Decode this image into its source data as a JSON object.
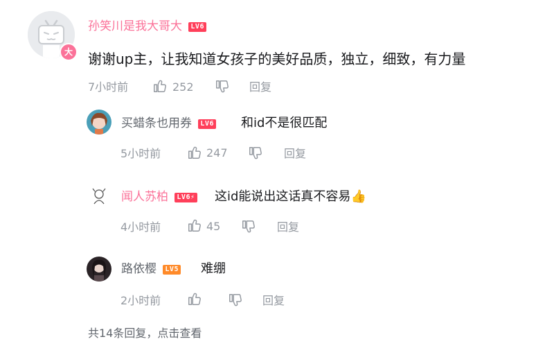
{
  "main_comment": {
    "username": "孙笑川是我大哥大",
    "level": "LV6",
    "avatar_badge": "大",
    "text": "谢谢up主，让我知道女孩子的美好品质，独立，细致，有力量",
    "time": "7小时前",
    "likes": "252",
    "reply_label": "回复"
  },
  "replies": [
    {
      "username": "买蜡条也用券",
      "level": "LV6",
      "text": "和id不是很匹配",
      "time": "5小时前",
      "likes": "247",
      "reply_label": "回复"
    },
    {
      "username": "闻人苏柏",
      "level": "LV6",
      "level_flag": "⚡",
      "text": "这id能说出这话真不容易",
      "emoji": "👍",
      "time": "4小时前",
      "likes": "45",
      "reply_label": "回复"
    },
    {
      "username": "路依樱",
      "level": "LV5",
      "text": "难绷",
      "time": "2小时前",
      "likes": "",
      "reply_label": "回复"
    }
  ],
  "footer": {
    "more_replies": "共14条回复，点击查看"
  },
  "colors": {
    "vip_pink": "#fb7299",
    "lv6": "#ff3f5a",
    "lv5": "#ff8a29",
    "meta_grey": "#9499a0"
  }
}
